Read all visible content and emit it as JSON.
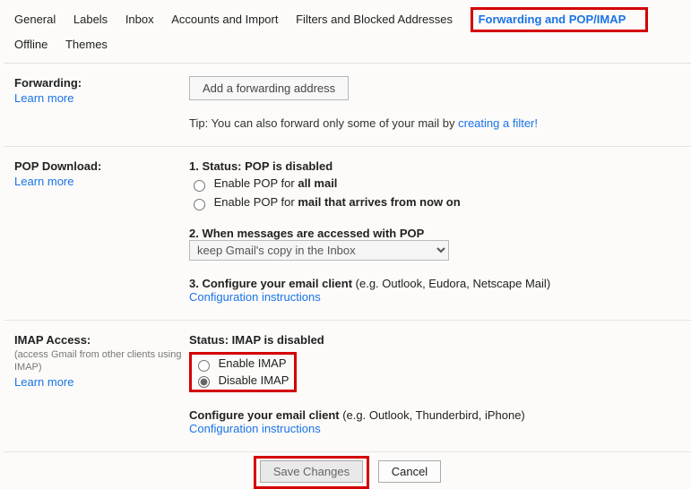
{
  "tabs": {
    "general": "General",
    "labels": "Labels",
    "inbox": "Inbox",
    "accounts": "Accounts and Import",
    "filters": "Filters and Blocked Addresses",
    "forwarding": "Forwarding and POP/IMAP",
    "offline": "Offline",
    "themes": "Themes"
  },
  "forwarding": {
    "title": "Forwarding:",
    "learn": "Learn more",
    "add_button": "Add a forwarding address",
    "tip_prefix": "Tip: You can also forward only some of your mail by ",
    "tip_link": "creating a filter!"
  },
  "pop": {
    "title": "POP Download:",
    "learn": "Learn more",
    "status_label": "1. Status: ",
    "status_value": "POP is disabled",
    "opt_all_prefix": "Enable POP for ",
    "opt_all_bold": "all mail",
    "opt_now_prefix": "Enable POP for ",
    "opt_now_bold": "mail that arrives from now on",
    "step2": "2. When messages are accessed with POP",
    "select_value": "keep Gmail's copy in the Inbox",
    "step3_prefix": "3. Configure your email client ",
    "step3_eg": "(e.g. Outlook, Eudora, Netscape Mail)",
    "config_link": "Configuration instructions"
  },
  "imap": {
    "title": "IMAP Access:",
    "sub": "(access Gmail from other clients using IMAP)",
    "learn": "Learn more",
    "status_label": "Status: ",
    "status_value": "IMAP is disabled",
    "opt_enable": "Enable IMAP",
    "opt_disable": "Disable IMAP",
    "config_prefix": "Configure your email client ",
    "config_eg": "(e.g. Outlook, Thunderbird, iPhone)",
    "config_link": "Configuration instructions"
  },
  "footer": {
    "save": "Save Changes",
    "cancel": "Cancel"
  }
}
